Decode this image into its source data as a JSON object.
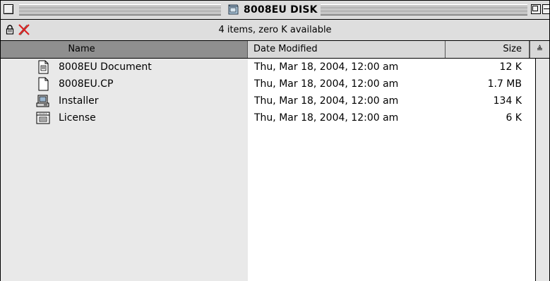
{
  "window": {
    "title": "8008EU DISK",
    "info": "4 items, zero K available"
  },
  "columns": {
    "name": "Name",
    "date": "Date Modified",
    "size": "Size",
    "sort_glyph": "≜"
  },
  "files": [
    {
      "name": "8008EU Document",
      "date": "Thu, Mar 18, 2004, 12:00 am",
      "size": "12 K",
      "icon": "document-icon"
    },
    {
      "name": "8008EU.CP",
      "date": "Thu, Mar 18, 2004, 12:00 am",
      "size": "1.7 MB",
      "icon": "blank-file-icon"
    },
    {
      "name": "Installer",
      "date": "Thu, Mar 18, 2004, 12:00 am",
      "size": "134 K",
      "icon": "installer-icon"
    },
    {
      "name": "License",
      "date": "Thu, Mar 18, 2004, 12:00 am",
      "size": "6 K",
      "icon": "license-icon"
    }
  ],
  "colors": {
    "name_column_bg": "#e9e9e9",
    "header_selected": "#8f8f8f"
  }
}
